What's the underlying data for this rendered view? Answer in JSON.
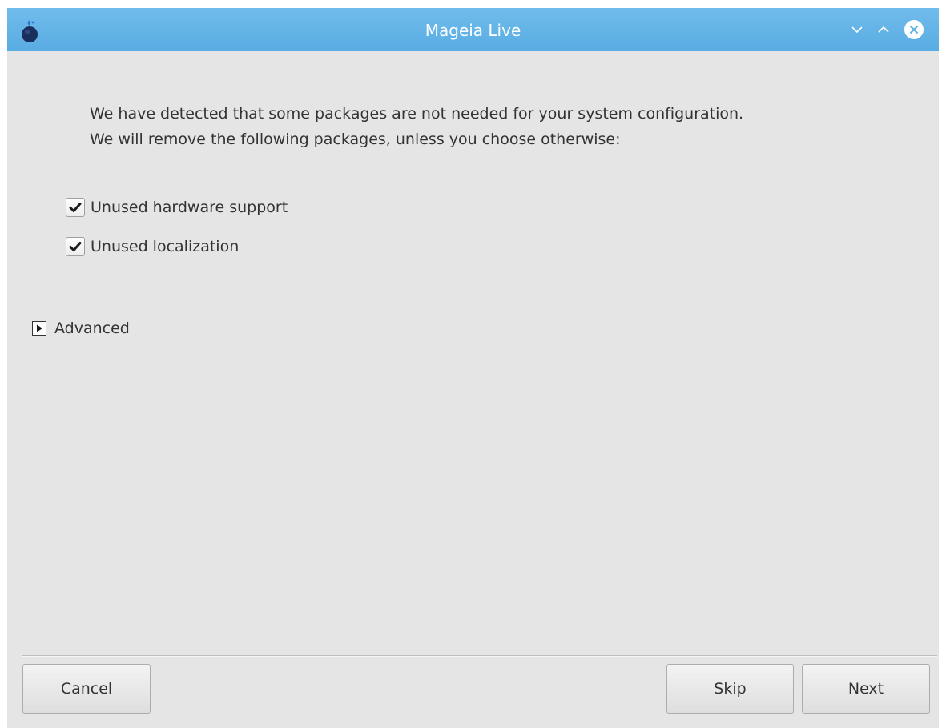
{
  "window": {
    "title": "Mageia Live",
    "titlebar_color": "#5fb2e6",
    "icons": [
      "mageia-logo-icon",
      "minimize-icon",
      "maximize-icon",
      "close-icon"
    ]
  },
  "dialog": {
    "intro_line1": "We have detected that some packages are not needed for your system configuration.",
    "intro_line2": "We will remove the following packages, unless you choose otherwise:",
    "options": [
      {
        "label": "Unused hardware support",
        "checked": true
      },
      {
        "label": "Unused localization",
        "checked": true
      }
    ],
    "advanced_label": "Advanced",
    "advanced_expanded": false
  },
  "buttons": {
    "cancel": "Cancel",
    "skip": "Skip",
    "next": "Next"
  }
}
